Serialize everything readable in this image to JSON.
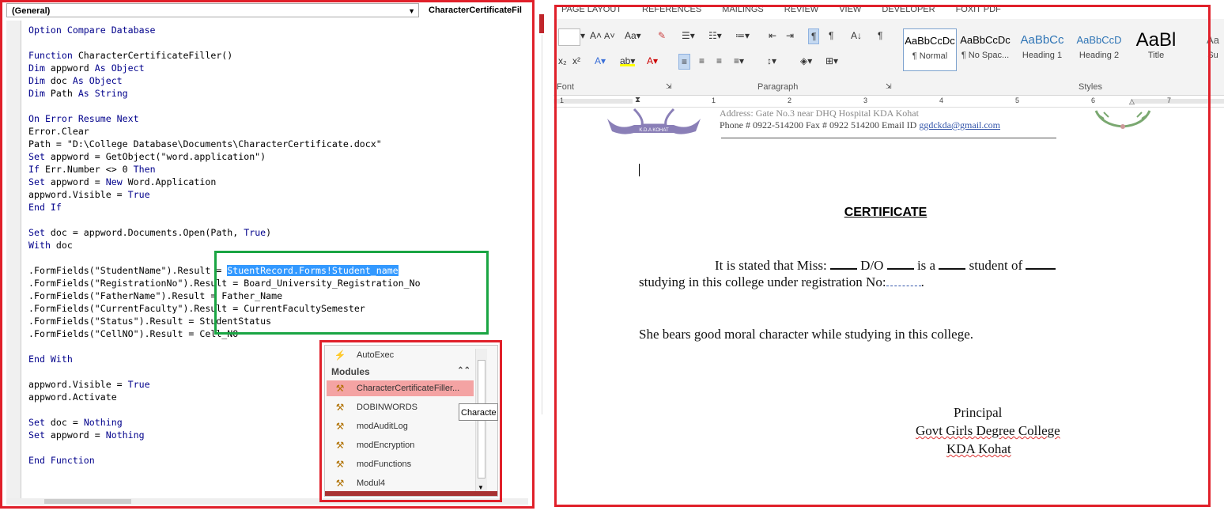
{
  "vba": {
    "combo_left": "(General)",
    "combo_right": "CharacterCertificateFil",
    "code": [
      [
        {
          "t": "Option Compare Database",
          "k": true
        }
      ],
      [],
      [
        {
          "t": "Function ",
          "k": true
        },
        {
          "t": "CharacterCertificateFiller()"
        }
      ],
      [
        {
          "t": "Dim ",
          "k": true
        },
        {
          "t": "appword "
        },
        {
          "t": "As Object",
          "k": true
        }
      ],
      [
        {
          "t": "Dim ",
          "k": true
        },
        {
          "t": "doc "
        },
        {
          "t": "As Object",
          "k": true
        }
      ],
      [
        {
          "t": "Dim ",
          "k": true
        },
        {
          "t": "Path "
        },
        {
          "t": "As String",
          "k": true
        }
      ],
      [],
      [
        {
          "t": "On Error Resume Next",
          "k": true
        }
      ],
      [
        {
          "t": "Error.Clear"
        }
      ],
      [
        {
          "t": "Path = \"D:\\College Database\\Documents\\CharacterCertificate.docx\""
        }
      ],
      [
        {
          "t": "Set ",
          "k": true
        },
        {
          "t": "appword = GetObject(\"word.application\")"
        }
      ],
      [
        {
          "t": "If ",
          "k": true
        },
        {
          "t": "Err.Number <> 0 "
        },
        {
          "t": "Then",
          "k": true
        }
      ],
      [
        {
          "t": "Set ",
          "k": true
        },
        {
          "t": "appword = "
        },
        {
          "t": "New ",
          "k": true
        },
        {
          "t": "Word.Application"
        }
      ],
      [
        {
          "t": "appword.Visible = "
        },
        {
          "t": "True",
          "k": true
        }
      ],
      [
        {
          "t": "End If",
          "k": true
        }
      ],
      [],
      [
        {
          "t": "Set ",
          "k": true
        },
        {
          "t": "doc = appword.Documents.Open(Path, "
        },
        {
          "t": "True",
          "k": true
        },
        {
          "t": ")"
        }
      ],
      [
        {
          "t": "With ",
          "k": true
        },
        {
          "t": "doc"
        }
      ],
      [],
      [
        {
          "t": ".FormFields(\"StudentName\").Result = "
        },
        {
          "t": "StuentRecord.Forms!Student_name",
          "s": true
        }
      ],
      [
        {
          "t": ".FormFields(\"RegistrationNo\").Result = Board_University_Registration_No"
        }
      ],
      [
        {
          "t": ".FormFields(\"FatherName\").Result = Father_Name"
        }
      ],
      [
        {
          "t": ".FormFields(\"CurrentFaculty\").Result = CurrentFacultySemester"
        }
      ],
      [
        {
          "t": ".FormFields(\"Status\").Result = StudentStatus"
        }
      ],
      [
        {
          "t": ".FormFields(\"CellNO\").Result = Cell_NO"
        }
      ],
      [],
      [
        {
          "t": "End With",
          "k": true
        }
      ],
      [],
      [
        {
          "t": "appword.Visible = "
        },
        {
          "t": "True",
          "k": true
        }
      ],
      [
        {
          "t": "appword.Activate"
        }
      ],
      [],
      [
        {
          "t": "Set ",
          "k": true
        },
        {
          "t": "doc = "
        },
        {
          "t": "Nothing",
          "k": true
        }
      ],
      [
        {
          "t": "Set ",
          "k": true
        },
        {
          "t": "appword = "
        },
        {
          "t": "Nothing",
          "k": true
        }
      ],
      [],
      [
        {
          "t": "End Function",
          "k": true
        }
      ]
    ],
    "popup": {
      "top_item": "AutoExec",
      "header": "Modules",
      "items": [
        "CharacterCertificateFiller...",
        "DOBINWORDS",
        "modAuditLog",
        "modEncryption",
        "modFunctions",
        "Modul4"
      ],
      "active_index": 0,
      "tooltip": "Characte"
    }
  },
  "word": {
    "tabs": [
      "PAGE LAYOUT",
      "REFERENCES",
      "MAILINGS",
      "REVIEW",
      "VIEW",
      "DEVELOPER",
      "FOXIT PDF"
    ],
    "groups": {
      "font": "Font",
      "paragraph": "Paragraph",
      "styles": "Styles"
    },
    "styles": [
      {
        "preview": "AaBbCcDc",
        "name": "¶ Normal"
      },
      {
        "preview": "AaBbCcDc",
        "name": "¶ No Spac..."
      },
      {
        "preview": "AaBbCc",
        "name": "Heading 1"
      },
      {
        "preview": "AaBbCcD",
        "name": "Heading 2"
      },
      {
        "preview": "AaBl",
        "name": "Title"
      },
      {
        "preview": "Aa",
        "name": "Su"
      }
    ],
    "ruler_numbers": [
      "1",
      "1",
      "2",
      "3",
      "4",
      "5",
      "6",
      "7"
    ],
    "document": {
      "header_address": "Address: Gate No.3 near DHQ Hospital KDA Kohat",
      "header_phone": "Phone # 0922-514200 Fax # 0922 514200 Email ID ",
      "header_email": "ggdckda@gmail.com",
      "logo_text": "K.D.A KOHAT",
      "title": "CERTIFICATE",
      "p1_a": "It is stated that Miss: ",
      "p1_b": " D/O ",
      "p1_c": " is a ",
      "p1_d": " student of ",
      "p1_line2": "studying in this college under registration No:",
      "p2": "She bears good moral character while studying in this college.",
      "sig1": "Principal",
      "sig2": "Govt Girls Degree College",
      "sig3": "KDA Kohat"
    }
  },
  "colors": {
    "annotation_red": "#e0202a",
    "annotation_green": "#1aa543",
    "vba_keyword": "#00008b",
    "selection": "#3399ff"
  }
}
